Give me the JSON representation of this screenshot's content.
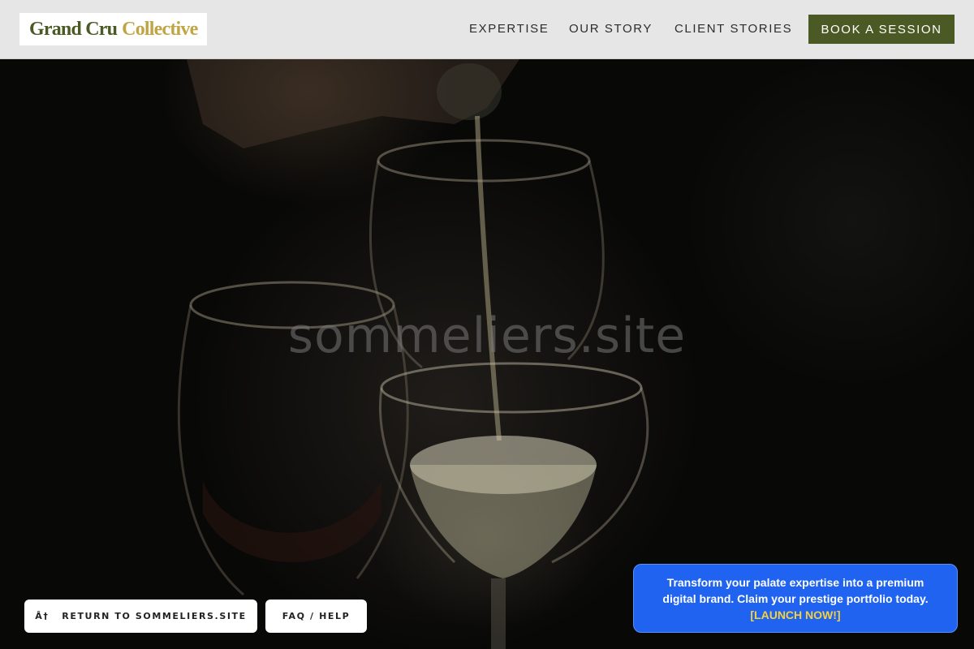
{
  "header": {
    "logo": {
      "part_a": "Grand Cru",
      "part_b": "Collective"
    },
    "nav": [
      {
        "label": "EXPERTISE"
      },
      {
        "label": "OUR STORY"
      },
      {
        "label": "CLIENT STORIES"
      }
    ],
    "cta_label": "BOOK A SESSION"
  },
  "hero": {
    "watermark": "sommeliers.site",
    "image_subject": "wine-pouring-glasses-photo"
  },
  "footer_buttons": {
    "return_label": "Â† RETURN TO SOMMELIERS.SITE",
    "faq_label": "FAQ / HELP"
  },
  "promo": {
    "line1": "Transform your palate expertise into a premium digital brand. Claim your prestige portfolio today.",
    "cta": "[LAUNCH NOW!]"
  },
  "colors": {
    "brand_green": "#4b5a24",
    "brand_gold": "#c1a544",
    "header_bg": "#e6e6e6",
    "promo_blue": "#1f63f0",
    "promo_cta_yellow": "#f5d13b"
  }
}
